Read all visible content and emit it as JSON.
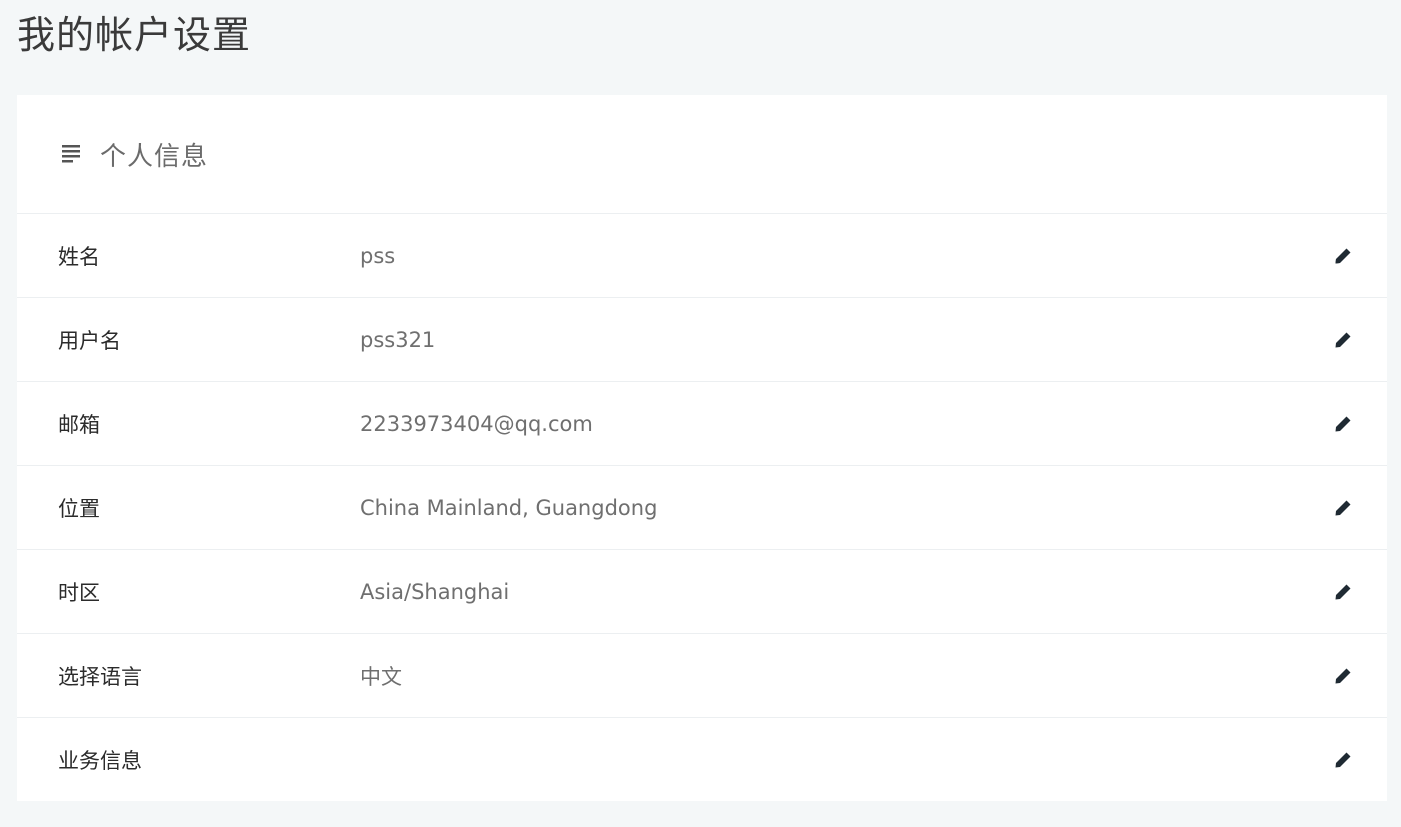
{
  "page": {
    "title": "我的帐户设置"
  },
  "card": {
    "icon": "list-icon",
    "title": "个人信息"
  },
  "rows": [
    {
      "label": "姓名",
      "value": "pss",
      "action_icon": "pencil-icon"
    },
    {
      "label": "用户名",
      "value": "pss321",
      "action_icon": "pencil-icon"
    },
    {
      "label": "邮箱",
      "value": "2233973404@qq.com",
      "action_icon": "pencil-icon"
    },
    {
      "label": "位置",
      "value": "China Mainland, Guangdong",
      "action_icon": "pencil-icon"
    },
    {
      "label": "时区",
      "value": "Asia/Shanghai",
      "action_icon": "pencil-icon"
    },
    {
      "label": "选择语言",
      "value": "中文",
      "action_icon": "pencil-icon"
    },
    {
      "label": "业务信息",
      "value": "",
      "action_icon": "pencil-icon"
    }
  ],
  "colors": {
    "background": "#f4f7f8",
    "card": "#ffffff",
    "divider": "#eceff1",
    "label": "#2b2b2b",
    "value": "#6f6f6f",
    "icon": "#1f2a33"
  }
}
